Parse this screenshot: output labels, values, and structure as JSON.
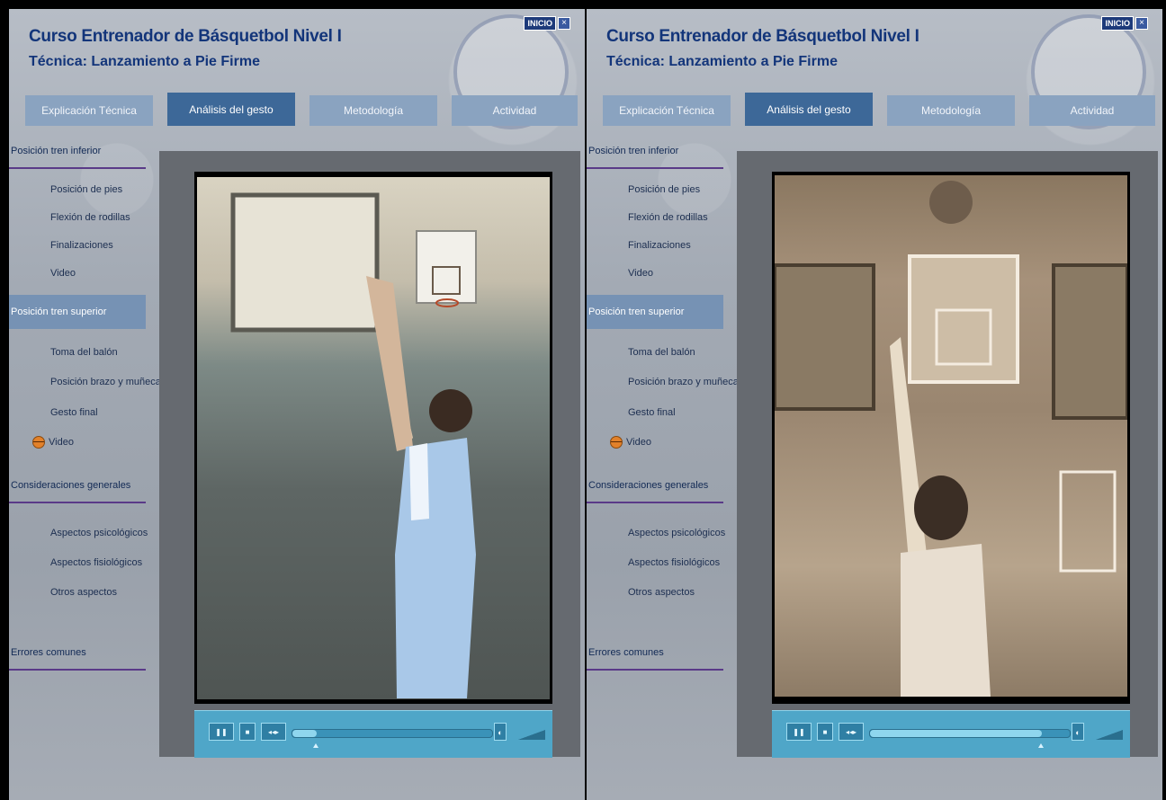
{
  "panels": [
    {
      "title": "Curso Entrenador de Básquetbol Nivel I",
      "subtitle": "Técnica: Lanzamiento a Pie Firme",
      "inicio_label": "INICIO",
      "tabs": [
        "Explicación Técnica",
        "Análisis del gesto",
        "Metodología",
        "Actividad"
      ],
      "active_tab": "Análisis del gesto",
      "sections": [
        {
          "label": "Posición tren inferior",
          "items": [
            "Posición de pies",
            "Flexión de rodillas",
            "Finalizaciones",
            "Video"
          ]
        },
        {
          "label": "Posición tren superior",
          "items": [
            "Toma del balón",
            "Posición brazo y muñeca",
            "Gesto final",
            "Video"
          ]
        },
        {
          "label": "Consideraciones generales",
          "items": [
            "Aspectos psicológicos",
            "Aspectos fisiológicos",
            "Otros aspectos"
          ]
        },
        {
          "label": "Errores comunes",
          "items": []
        }
      ],
      "player": {
        "progress": 0.12
      }
    },
    {
      "title": "Curso Entrenador de Básquetbol Nivel I",
      "subtitle": "Técnica: Lanzamiento a Pie Firme",
      "inicio_label": "INICIO",
      "tabs": [
        "Explicación Técnica",
        "Análisis del gesto",
        "Metodología",
        "Actividad"
      ],
      "active_tab": "Análisis del gesto",
      "sections": [
        {
          "label": "Posición tren inferior",
          "items": [
            "Posición de pies",
            "Flexión de rodillas",
            "Finalizaciones",
            "Video"
          ]
        },
        {
          "label": "Posición tren superior",
          "items": [
            "Toma del balón",
            "Posición brazo y muñeca",
            "Gesto final",
            "Video"
          ]
        },
        {
          "label": "Consideraciones generales",
          "items": [
            "Aspectos psicológicos",
            "Aspectos fisiológicos",
            "Otros aspectos"
          ]
        },
        {
          "label": "Errores comunes",
          "items": []
        }
      ],
      "player": {
        "progress": 0.86
      }
    }
  ],
  "colors": {
    "title": "#13357a",
    "active_tab": "#3d6898",
    "player": "#4fa6c8"
  }
}
